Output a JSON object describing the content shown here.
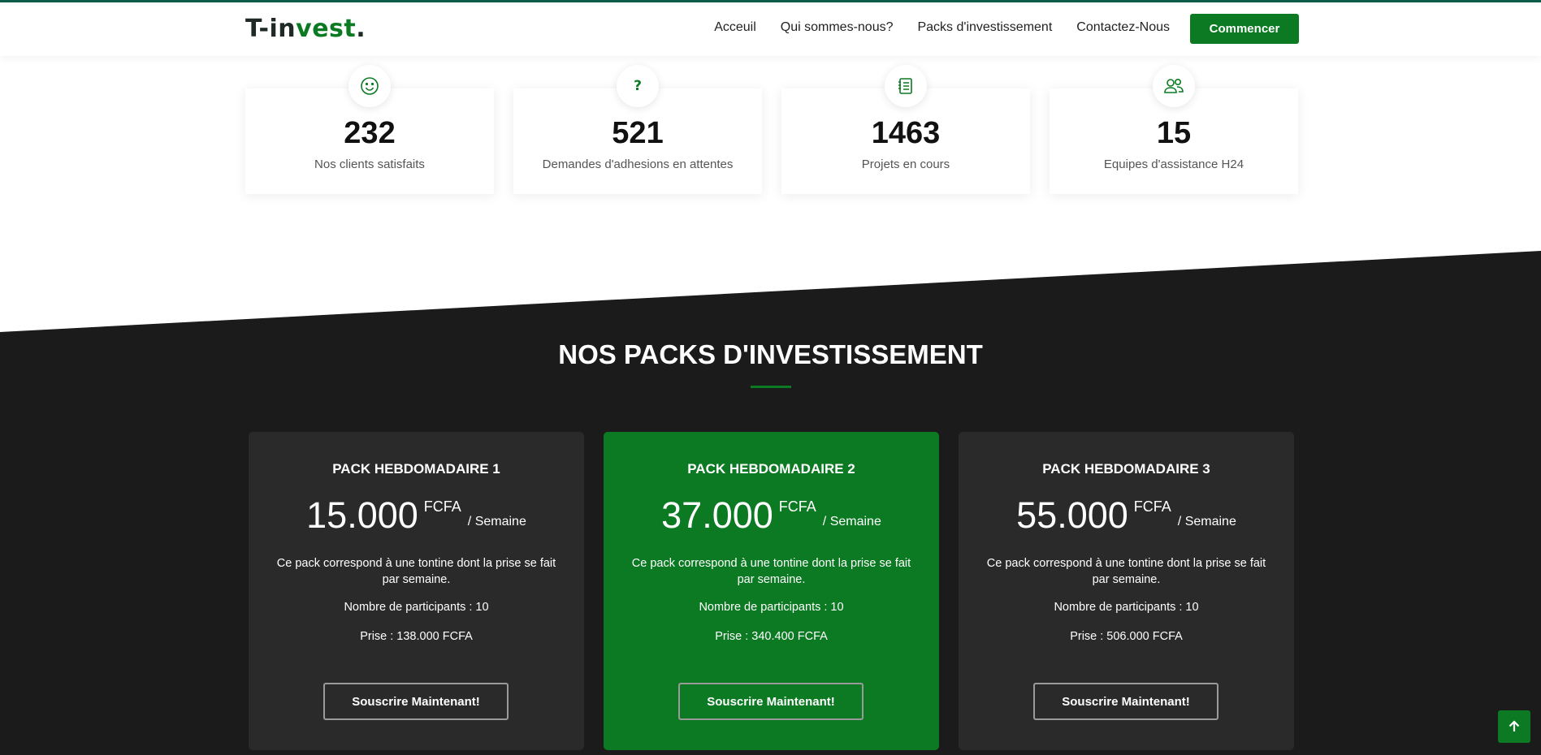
{
  "brand": {
    "prefix": "T-in",
    "suffix": "vest",
    "dot": ".",
    "accent": "#0b7a22"
  },
  "nav": {
    "items": [
      "Acceuil",
      "Qui sommes-nous?",
      "Packs d'investissement",
      "Contactez-Nous"
    ],
    "cta": "Commencer"
  },
  "stats": [
    {
      "icon": "smiley-icon",
      "value": "232",
      "label": "Nos clients satisfaits"
    },
    {
      "icon": "question-icon",
      "value": "521",
      "label": "Demandes d'adhesions en attentes"
    },
    {
      "icon": "document-list-icon",
      "value": "1463",
      "label": "Projets en cours"
    },
    {
      "icon": "people-icon",
      "value": "15",
      "label": "Equipes d'assistance H24"
    }
  ],
  "packs": {
    "title": "NOS PACKS D'INVESTISSEMENT",
    "items": [
      {
        "title": "PACK HEBDOMADAIRE 1",
        "amount": "15.000",
        "currency": "FCFA",
        "period": "/ Semaine",
        "description": "Ce pack correspond à une tontine dont la prise se fait par semaine.",
        "participants": "Nombre de participants : 10",
        "prise": "Prise : 138.000 FCFA",
        "button": "Souscrire Maintenant!"
      },
      {
        "title": "PACK HEBDOMADAIRE 2",
        "amount": "37.000",
        "currency": "FCFA",
        "period": "/ Semaine",
        "description": "Ce pack correspond à une tontine dont la prise se fait par semaine.",
        "participants": "Nombre de participants : 10",
        "prise": "Prise : 340.400 FCFA",
        "button": "Souscrire Maintenant!"
      },
      {
        "title": "PACK HEBDOMADAIRE 3",
        "amount": "55.000",
        "currency": "FCFA",
        "period": "/ Semaine",
        "description": "Ce pack correspond à une tontine dont la prise se fait par semaine.",
        "participants": "Nombre de participants : 10",
        "prise": "Prise : 506.000 FCFA",
        "button": "Souscrire Maintenant!"
      }
    ]
  },
  "back_to_top_icon": "arrow-up-icon"
}
